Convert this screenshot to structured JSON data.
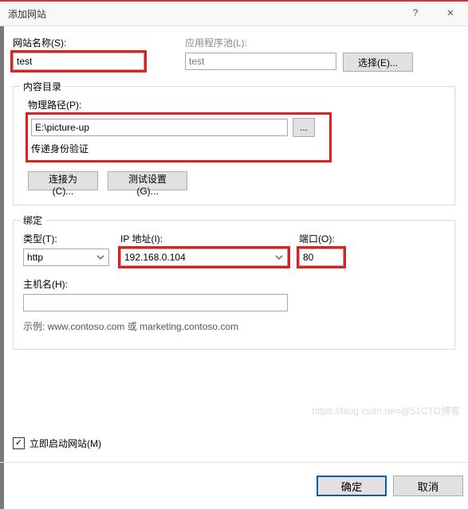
{
  "window": {
    "title": "添加网站",
    "help": "?",
    "close": "×"
  },
  "site_name": {
    "label": "网站名称(S):",
    "value": "test"
  },
  "app_pool": {
    "label": "应用程序池(L):",
    "value": "test",
    "select_btn": "选择(E)..."
  },
  "content_dir": {
    "legend": "内容目录",
    "path_label": "物理路径(P):",
    "path_value": "E:\\picture-up",
    "browse": "...",
    "auth_label": "传递身份验证",
    "connect_as": "连接为(C)...",
    "test_settings": "测试设置(G)..."
  },
  "binding": {
    "legend": "绑定",
    "type_label": "类型(T):",
    "type_value": "http",
    "ip_label": "IP 地址(I):",
    "ip_value": "192.168.0.104",
    "port_label": "端口(O):",
    "port_value": "80",
    "host_label": "主机名(H):",
    "host_value": "",
    "example": "示例: www.contoso.com 或 marketing.contoso.com"
  },
  "start_site": {
    "label": "立即启动网站(M)",
    "checked": true
  },
  "footer": {
    "ok": "确定",
    "cancel": "取消"
  },
  "watermark": "https://blog.csdn.ne=@51CTO博客"
}
